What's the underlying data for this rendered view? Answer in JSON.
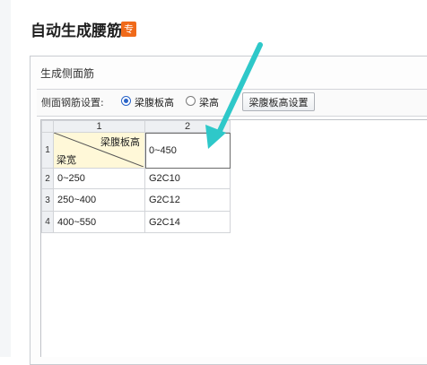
{
  "page": {
    "title": "自动生成腰筋",
    "badge": "专"
  },
  "dialog": {
    "title": "生成侧面筋",
    "toolbar": {
      "label": "侧面钢筋设置:",
      "options": [
        {
          "label": "梁腹板高",
          "checked": true
        },
        {
          "label": "梁高",
          "checked": false
        }
      ],
      "button_label": "梁腹板高设置"
    }
  },
  "grid": {
    "column_headers": [
      "1",
      "2"
    ],
    "corner_top": "梁腹板高",
    "corner_bottom": "梁宽",
    "rows": [
      {
        "index": "1",
        "col1": "",
        "col2": "0~450"
      },
      {
        "index": "2",
        "col1": "0~250",
        "col2": "G2C10"
      },
      {
        "index": "3",
        "col1": "250~400",
        "col2": "G2C12"
      },
      {
        "index": "4",
        "col1": "400~550",
        "col2": "G2C14"
      }
    ]
  },
  "annotation": {
    "arrow_color": "#2ec8c9"
  }
}
